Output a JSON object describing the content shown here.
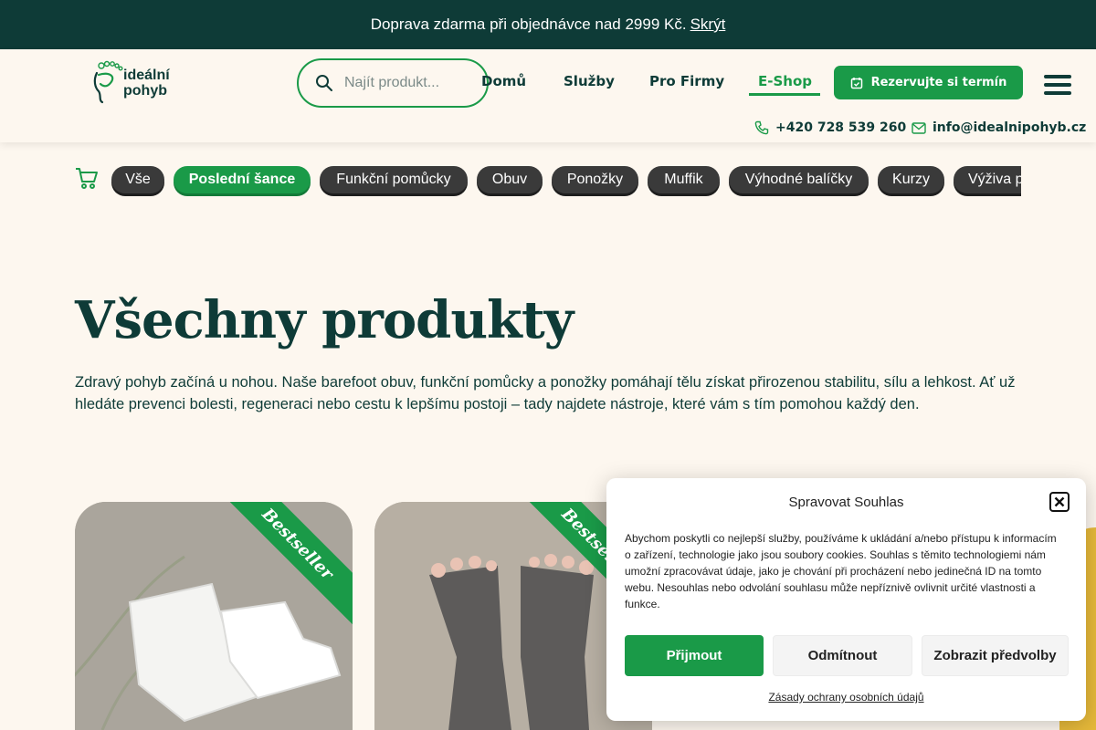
{
  "announcement": {
    "text": "Doprava zdarma při objednávce nad 2999 Kč.",
    "hide_label": "Skrýt"
  },
  "header": {
    "logo_line1": "ideální",
    "logo_line2": "pohyb",
    "search_placeholder": "Najít produkt...",
    "nav": [
      {
        "label": "Domů"
      },
      {
        "label": "Služby"
      },
      {
        "label": "Pro Firmy"
      },
      {
        "label": "E-Shop",
        "active": true
      }
    ],
    "cta_label": "Rezervujte si termín",
    "phone": "+420 728 539 260",
    "email": "info@idealnipohyb.cz"
  },
  "categories": [
    "Vše",
    "Poslední šance",
    "Funkční pomůcky",
    "Obuv",
    "Ponožky",
    "Muffik",
    "Výhodné balíčky",
    "Kurzy",
    "Výživa p"
  ],
  "active_category": "Poslední šance",
  "page": {
    "title": "Všechny produkty",
    "intro": "Zdravý pohyb začíná u nohou. Naše barefoot obuv, funkční pomůcky a ponožky pomáhají tělu získat přirozenou stabilitu, sílu a lehkost. Ať už hledáte prevenci bolesti, regeneraci nebo cestu k lepšímu postoji – tady najdete nástroje, které vám s tím pomohou každý den."
  },
  "products": [
    {
      "badge": "Bestseller"
    },
    {
      "badge": "Bestseller"
    }
  ],
  "consent": {
    "title": "Spravovat Souhlas",
    "body": "Abychom poskytli co nejlepší služby, používáme k ukládání a/nebo přístupu k informacím o zařízení, technologie jako jsou soubory cookies. Souhlas s těmito technologiemi nám umožní zpracovávat údaje, jako je chování při procházení nebo jedinečná ID na tomto webu. Nesouhlas nebo odvolání souhlasu může nepříznivě ovlivnit určité vlastnosti a funkce.",
    "accept_label": "Přijmout",
    "deny_label": "Odmítnout",
    "prefs_label": "Zobrazit předvolby",
    "policy_link": "Zásady ochrany osobních údajů"
  },
  "colors": {
    "brand_green": "#1a9a48",
    "dark_teal": "#0e3b37",
    "background": "#fdf7ef",
    "pill_dark": "#3a3a3a"
  },
  "icons": [
    "search-icon",
    "calendar-icon",
    "menu-icon",
    "phone-icon",
    "mail-icon",
    "cart-icon",
    "close-icon"
  ]
}
